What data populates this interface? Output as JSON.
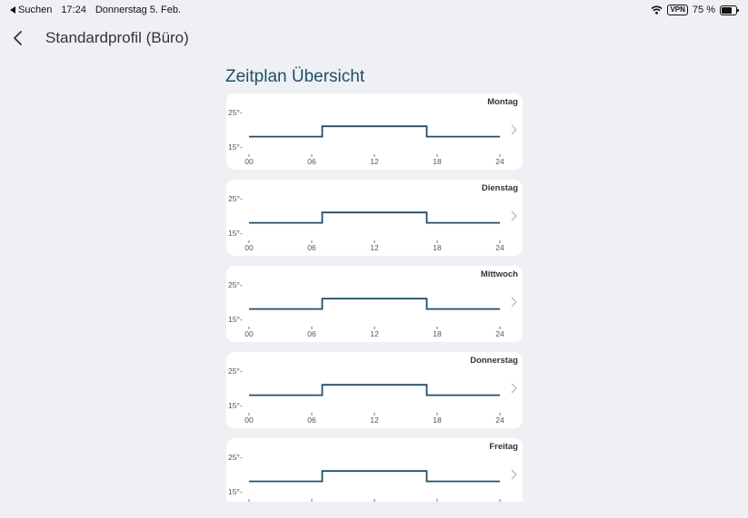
{
  "status_bar": {
    "back_app": "Suchen",
    "time": "17:24",
    "date": "Donnerstag 5. Feb.",
    "vpn": "VPN",
    "battery_text": "75 %",
    "battery_level": 0.75
  },
  "nav": {
    "title": "Standardprofil (Büro)"
  },
  "section_title": "Zeitplan Übersicht",
  "schedule": {
    "y_ticks": [
      "25°-",
      "15°-"
    ],
    "x_ticks": [
      "00",
      "06",
      "12",
      "18",
      "24"
    ],
    "days": [
      {
        "label": "Montag"
      },
      {
        "label": "Dienstag"
      },
      {
        "label": "Mittwoch"
      },
      {
        "label": "Donnerstag"
      },
      {
        "label": "Freitag"
      }
    ]
  },
  "chart_data": {
    "type": "line",
    "step": true,
    "xlabel": "",
    "ylabel": "",
    "xlim": [
      0,
      24
    ],
    "ylim": [
      15,
      25
    ],
    "x_ticks": [
      "00",
      "06",
      "12",
      "18",
      "24"
    ],
    "y_ticks": [
      "15°",
      "25°"
    ],
    "series": [
      {
        "x": [
          0,
          7,
          7,
          17,
          17,
          24
        ],
        "y": [
          18,
          18,
          21,
          21,
          18,
          18
        ]
      }
    ],
    "color": "#1f4e6b"
  }
}
